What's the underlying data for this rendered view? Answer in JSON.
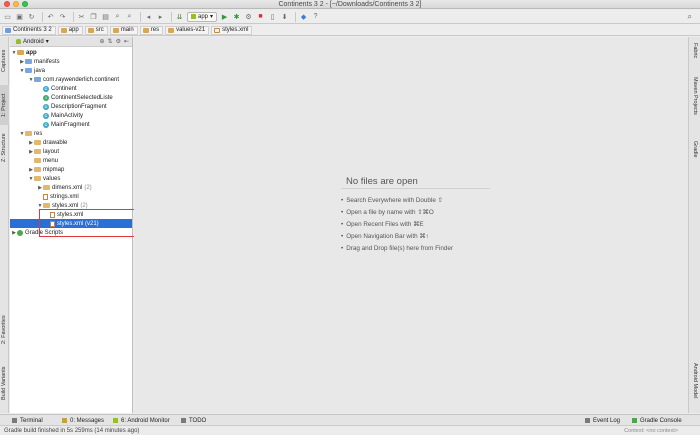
{
  "window": {
    "title": "Continents 3 2 - [~/Downloads/Continents 3 2]"
  },
  "toolbar": {
    "run_config": "app"
  },
  "breadcrumb": [
    "Continents 3 2",
    "app",
    "src",
    "main",
    "res",
    "values-v21",
    "styles.xml"
  ],
  "left_tabs": {
    "captures": "Captures",
    "project": "1: Project",
    "structure": "Z: Structure",
    "favorites": "2: Favorites",
    "build_variants": "Build Variants"
  },
  "right_tabs": {
    "fabric": "Fabric",
    "maven": "Maven Projects",
    "gradle": "Gradle",
    "android_model": "Android Model"
  },
  "project_panel": {
    "view_mode": "Android"
  },
  "tree": [
    {
      "label": "app",
      "note": ""
    },
    {
      "label": "manifests",
      "note": ""
    },
    {
      "label": "java",
      "note": ""
    },
    {
      "label": "com.raywenderlich.continent",
      "note": ""
    },
    {
      "label": "Continent",
      "note": ""
    },
    {
      "label": "ContinentSelectedListe",
      "note": ""
    },
    {
      "label": "DescriptionFragment",
      "note": ""
    },
    {
      "label": "MainActivity",
      "note": ""
    },
    {
      "label": "MainFragment",
      "note": ""
    },
    {
      "label": "res",
      "note": ""
    },
    {
      "label": "drawable",
      "note": ""
    },
    {
      "label": "layout",
      "note": ""
    },
    {
      "label": "menu",
      "note": ""
    },
    {
      "label": "mipmap",
      "note": ""
    },
    {
      "label": "values",
      "note": ""
    },
    {
      "label": "dimens.xml",
      "note": "(2)"
    },
    {
      "label": "strings.xml",
      "note": ""
    },
    {
      "label": "styles.xml",
      "note": "(2)"
    },
    {
      "label": "styles.xml",
      "note": ""
    },
    {
      "label": "styles.xml (v21)",
      "note": ""
    },
    {
      "label": "Gradle Scripts",
      "note": ""
    }
  ],
  "editor": {
    "empty_title": "No files are open",
    "hints": [
      "Search Everywhere with Double ⇧",
      "Open a file by name with ⇧⌘O",
      "Open Recent Files with ⌘E",
      "Open Navigation Bar with ⌘↑",
      "Drag and Drop file(s) here from Finder"
    ]
  },
  "bottom_tabs": {
    "terminal": "Terminal",
    "messages": "0: Messages",
    "android_monitor": "6: Android Monitor",
    "todo": "TODO",
    "event_log": "Event Log",
    "gradle_console": "Gradle Console"
  },
  "status": {
    "message": "Gradle build finished in 5s 259ms (14 minutes ago)",
    "context": "Context: <no context>"
  }
}
